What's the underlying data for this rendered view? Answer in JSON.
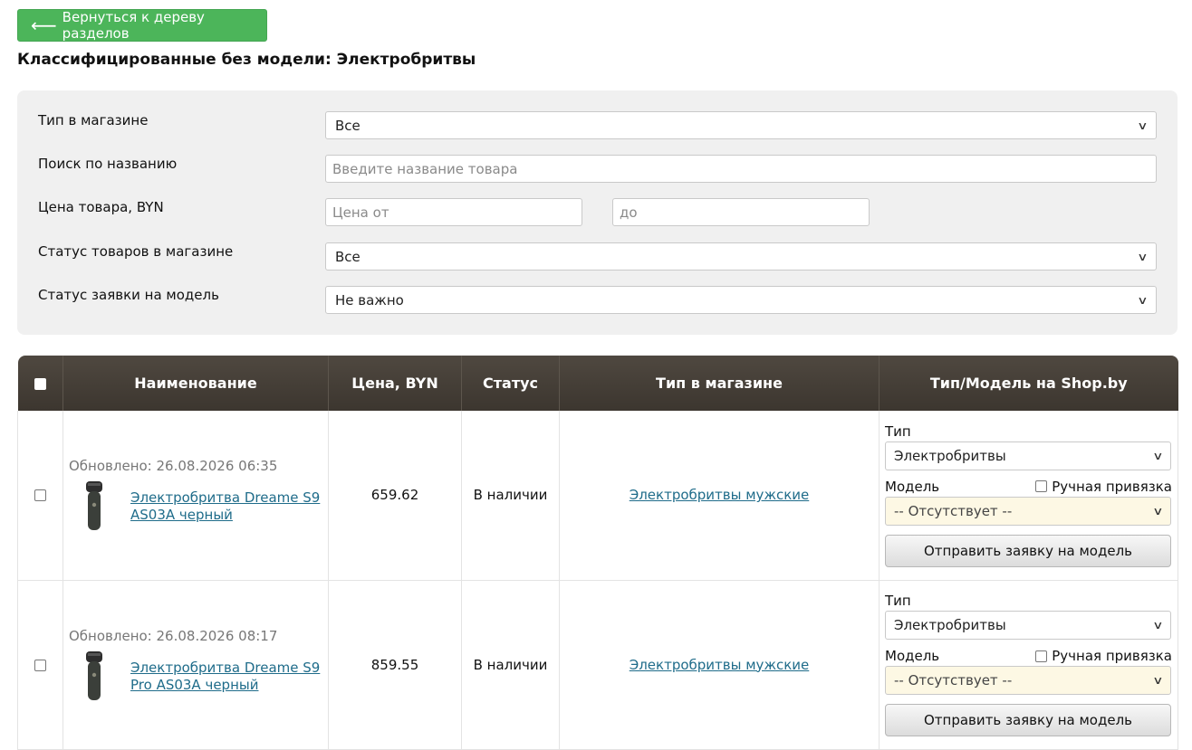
{
  "back_button": {
    "arrow": "⟵",
    "label": "Вернуться к дереву разделов"
  },
  "page_title": "Классифицированные без модели: Электробритвы",
  "filters": {
    "shop_type": {
      "label": "Тип в магазине",
      "value": "Все"
    },
    "search": {
      "label": "Поиск по названию",
      "placeholder": "Введите название товара"
    },
    "price": {
      "label": "Цена товара, BYN",
      "from_placeholder": "Цена от",
      "to_placeholder": "до"
    },
    "stock_status": {
      "label": "Статус товаров в магазине",
      "value": "Все"
    },
    "request_status": {
      "label": "Статус заявки на модель",
      "value": "Не важно"
    }
  },
  "table": {
    "headers": {
      "name": "Наименование",
      "price": "Цена, BYN",
      "status": "Статус",
      "shop_type": "Тип в магазине",
      "shopby": "Тип/Модель на Shop.by"
    },
    "rows": [
      {
        "updated": "Обновлено: 26.08.2026 06:35",
        "name_line1": "Электробритва Dreame S9",
        "name_line2": "AS03A черный",
        "price": "659.62",
        "status": "В наличии",
        "shop_type": "Электробритвы мужские",
        "type_label": "Тип",
        "type_value": "Электробритвы",
        "model_label": "Модель",
        "manual_label": "Ручная привязка",
        "model_value": "-- Отсутствует --",
        "submit_label": "Отправить заявку на модель"
      },
      {
        "updated": "Обновлено: 26.08.2026 08:17",
        "name_line1": "Электробритва Dreame S9",
        "name_line2": "Pro AS03A черный",
        "price": "859.55",
        "status": "В наличии",
        "shop_type": "Электробритвы мужские",
        "type_label": "Тип",
        "type_value": "Электробритвы",
        "model_label": "Модель",
        "manual_label": "Ручная привязка",
        "model_value": "-- Отсутствует --",
        "submit_label": "Отправить заявку на модель"
      }
    ]
  }
}
